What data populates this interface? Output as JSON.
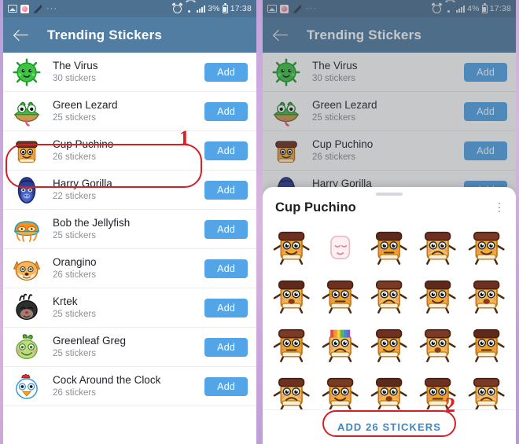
{
  "status_bar": {
    "left_icons": [
      "photo-icon",
      "pink-app-icon",
      "swoosh-icon"
    ],
    "overflow": "···",
    "right_icons": [
      "alarm-icon",
      "wifi-icon",
      "signal-icon",
      "battery-icon"
    ],
    "battery_left": "3%",
    "battery_right": "4%",
    "time": "17:38"
  },
  "app_bar": {
    "back_icon": "back-arrow-icon",
    "title": "Trending Stickers"
  },
  "colors": {
    "status_bar": "#4c7191",
    "app_bar": "#517da2",
    "add_button": "#54a5e8",
    "cta_text": "#3d86c6",
    "annotation_red": "#cf2229",
    "background": "#c2a3da"
  },
  "packs": [
    {
      "title": "The Virus",
      "count": "30 stickers",
      "add_label": "Add",
      "thumb": "virus-thumb"
    },
    {
      "title": "Green Lezard",
      "count": "25 stickers",
      "add_label": "Add",
      "thumb": "lizard-thumb"
    },
    {
      "title": "Cup Puchino",
      "count": "26 stickers",
      "add_label": "Add",
      "thumb": "cup-thumb"
    },
    {
      "title": "Harry Gorilla",
      "count": "22 stickers",
      "add_label": "Add",
      "thumb": "gorilla-thumb"
    },
    {
      "title": "Bob the Jellyfish",
      "count": "25 stickers",
      "add_label": "Add",
      "thumb": "jellyfish-thumb"
    },
    {
      "title": "Orangino",
      "count": "26 stickers",
      "add_label": "Add",
      "thumb": "fox-thumb"
    },
    {
      "title": "Krtek",
      "count": "25 stickers",
      "add_label": "Add",
      "thumb": "mole-thumb"
    },
    {
      "title": "Greenleaf Greg",
      "count": "25 stickers",
      "add_label": "Add",
      "thumb": "greenleaf-thumb"
    },
    {
      "title": "Cock Around the Clock",
      "count": "26 stickers",
      "add_label": "Add",
      "thumb": "rooster-thumb"
    }
  ],
  "sheet": {
    "handle": "drag-handle",
    "title": "Cup Puchino",
    "menu_icon": "kebab-menu-icon",
    "cta_label": "ADD 26 STICKERS",
    "sticker_count": 20
  },
  "annotations": [
    {
      "label": "1",
      "target": "cup-puchino-row"
    },
    {
      "label": "2",
      "target": "add-26-stickers-button"
    }
  ]
}
